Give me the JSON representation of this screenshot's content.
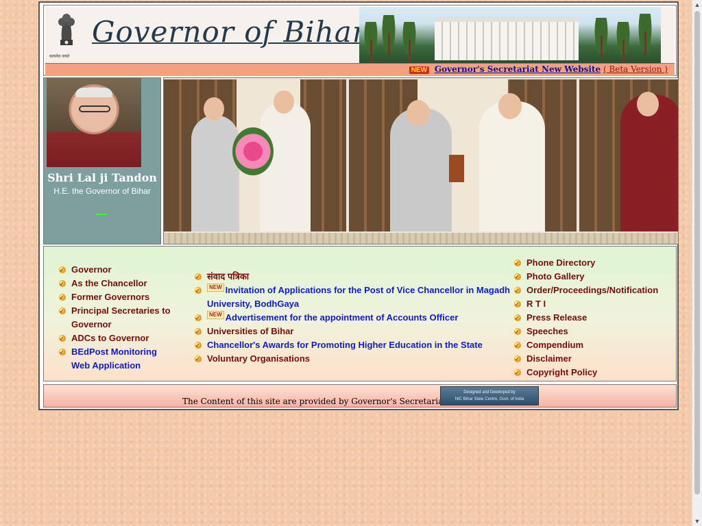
{
  "header": {
    "title": "Governor of Bihar",
    "emblem_motto": "सत्यमेव जयते",
    "news": {
      "badge": "NEW",
      "link_text": "Governor's Secretariat New Website",
      "beta_text": "( Beta Version )"
    }
  },
  "profile": {
    "name": "Shri Lal ji Tandon",
    "designation": "H.E. the Governor of Bihar"
  },
  "menu_left": [
    "Governor",
    "As the Chancellor",
    "Former Governors",
    "Principal Secretaries to Governor",
    "ADCs to Governor",
    "BEdPost Monitoring Web Application"
  ],
  "menu_center": [
    {
      "label": "संवाद पत्रिका",
      "new": false
    },
    {
      "label": "Invitation of Applications for the Post of Vice Chancellor in Magadh University, BodhGaya",
      "new": true
    },
    {
      "label": "Advertisement for the appointment of Accounts Officer",
      "new": true
    },
    {
      "label": "Universities of Bihar",
      "new": false
    },
    {
      "label": "Chancellor's Awards for Promoting Higher Education in the State",
      "new": false
    },
    {
      "label": "Voluntary Organisations",
      "new": false
    }
  ],
  "menu_right": [
    "Phone Directory",
    "Photo Gallery",
    "Order/Proceedings/Notification",
    "R T I",
    "Press Release",
    "Speeches",
    "Compendium",
    "Disclaimer",
    "Copyright Policy"
  ],
  "footer": {
    "text": "The Content of this site are provided by Governor's Secretariat, Bihar",
    "nic_line1": "Designed and Developed by",
    "nic_line2": "NIC Bihar State Centre, Govt. of India"
  },
  "new_mini_label": "NEW",
  "colors": {
    "maroon_link": "#7a0b0b",
    "blue_link": "#0b1ad6",
    "news_bar": "#f2a27d",
    "profile_bg": "#7d9f9d"
  }
}
